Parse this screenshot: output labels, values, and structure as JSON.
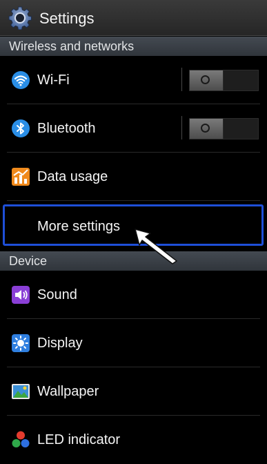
{
  "header": {
    "title": "Settings",
    "icon": "gear-icon"
  },
  "sections": {
    "wireless": "Wireless and networks",
    "device": "Device"
  },
  "items": {
    "wifi": {
      "label": "Wi-Fi",
      "icon": "wifi-icon",
      "toggle_on": false
    },
    "bluetooth": {
      "label": "Bluetooth",
      "icon": "bluetooth-icon",
      "toggle_on": false
    },
    "data_usage": {
      "label": "Data usage",
      "icon": "data-usage-icon"
    },
    "more_settings": {
      "label": "More settings",
      "focused": true
    },
    "sound": {
      "label": "Sound",
      "icon": "sound-icon"
    },
    "display": {
      "label": "Display",
      "icon": "display-icon"
    },
    "wallpaper": {
      "label": "Wallpaper",
      "icon": "wallpaper-icon"
    },
    "led": {
      "label": "LED indicator",
      "icon": "led-indicator-icon"
    }
  },
  "colors": {
    "focus": "#1e4fd8",
    "background": "#000000",
    "section_header": "#3a3f46"
  }
}
